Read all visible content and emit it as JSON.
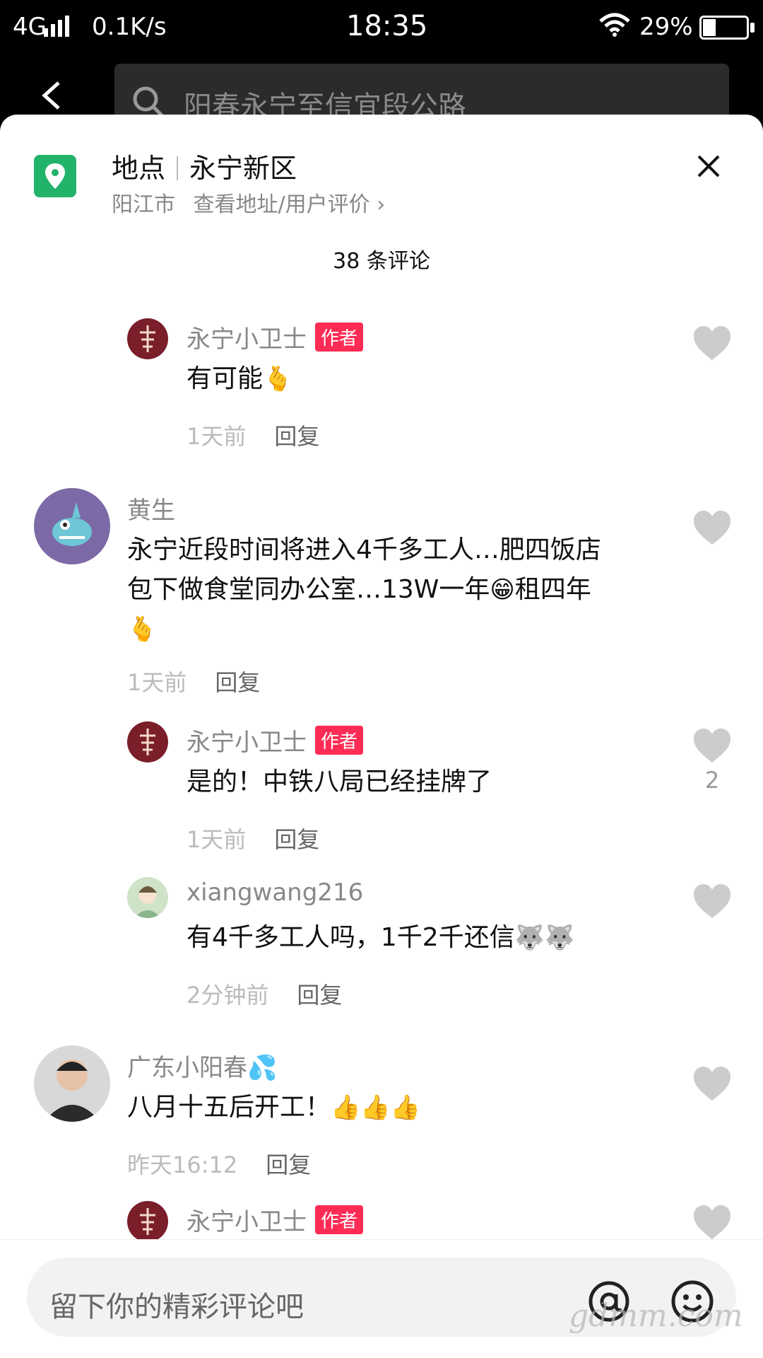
{
  "status_bar": {
    "signal": "4G",
    "speed": "0.1K/s",
    "time": "18:35",
    "battery": "29%"
  },
  "search": {
    "query": "阳春永宁至信宜段公路"
  },
  "location": {
    "label": "地点",
    "name": "永宁新区",
    "city": "阳江市",
    "link": "查看地址/用户评价",
    "icon_color": "#22b36a"
  },
  "comments_count": "38 条评论",
  "comments": [
    {
      "user": "永宁小卫士",
      "badge": "作者",
      "text": "有可能",
      "emoji": "🫰",
      "time": "1天前",
      "reply": "回复"
    },
    {
      "user": "黄生",
      "text_line1": "永宁近段时间将进入4千多工人…肥四饭店",
      "text_line2a": "包下做食堂同办公室…13W一年",
      "text_line2b": "租四年",
      "emoji_mid": "😁",
      "emoji_end": "🫰",
      "time": "1天前",
      "reply": "回复"
    },
    {
      "user": "永宁小卫士",
      "badge": "作者",
      "text": "是的！中铁八局已经挂牌了",
      "likes": "2",
      "time": "1天前",
      "reply": "回复"
    },
    {
      "user": "xiangwang216",
      "text": "有4千多工人吗，1千2千还信",
      "emoji": "🐺🐺",
      "time": "2分钟前",
      "reply": "回复"
    },
    {
      "user": "广东小阳春",
      "user_emoji": "💦",
      "text": "八月十五后开工！",
      "emoji": "👍👍👍",
      "time": "昨天16:12",
      "reply": "回复"
    },
    {
      "user": "永宁小卫士",
      "badge": "作者"
    }
  ],
  "input": {
    "placeholder": "留下你的精彩评论吧"
  },
  "watermark": "gdmm.com",
  "colors": {
    "badge": "#fe2c55",
    "heart": "#cccccc"
  }
}
